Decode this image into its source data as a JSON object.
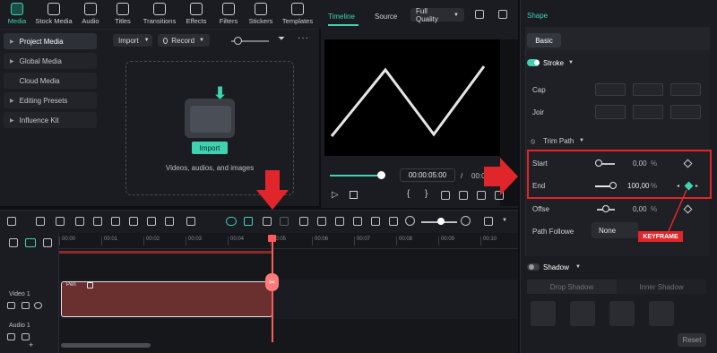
{
  "toolbar": {
    "items": [
      {
        "label": "Media",
        "icon": "media-icon",
        "active": true
      },
      {
        "label": "Stock Media",
        "icon": "cloud-icon"
      },
      {
        "label": "Audio",
        "icon": "music-icon"
      },
      {
        "label": "Titles",
        "icon": "text-icon"
      },
      {
        "label": "Transitions",
        "icon": "transition-icon"
      },
      {
        "label": "Effects",
        "icon": "effects-icon"
      },
      {
        "label": "Filters",
        "icon": "filter-icon"
      },
      {
        "label": "Stickers",
        "icon": "sticker-icon"
      },
      {
        "label": "Templates",
        "icon": "template-icon"
      }
    ]
  },
  "leftnav": {
    "items": [
      "Project Media",
      "Global Media",
      "Cloud Media",
      "Editing Presets",
      "Influence Kit"
    ]
  },
  "media": {
    "import_label": "Import",
    "record_label": "Record",
    "import_button": "Import",
    "hint": "Videos, audios, and images"
  },
  "player": {
    "tab_timeline": "Timeline",
    "tab_source": "Source",
    "quality": "Full Quality",
    "time_current": "00:00:05:00",
    "time_sep": "/",
    "time_total": "00:0"
  },
  "right": {
    "title": "Shape",
    "tab_basic": "Basic",
    "stroke": "Stroke",
    "cap": "Cap",
    "join": "Joir",
    "trim_path": "Trim Path",
    "start_label": "Start",
    "start_value": "0,00",
    "start_unit": "%",
    "end_label": "End",
    "end_value": "100,00",
    "end_unit": "%",
    "offset_label": "Offse",
    "offset_value": "0,00",
    "offset_unit": "%",
    "path_follow_label": "Path Followe",
    "path_follow_value": "None",
    "keyframe_annotation": "KEYFRAME",
    "shadow": "Shadow",
    "drop_shadow": "Drop Shadow",
    "inner_shadow": "Inner Shadow",
    "reset": "Reset",
    "accent": "#3fd2b0",
    "highlight": "#e0262a"
  },
  "timeline": {
    "ticks": [
      "00:00",
      "00:01",
      "00:02",
      "00:03",
      "00:04",
      "00:05",
      "00:06",
      "00:07",
      "00:08",
      "00:09",
      "00:10"
    ],
    "track_video": "Video 1",
    "track_audio": "Audio 1",
    "clip_label": "Pen"
  }
}
